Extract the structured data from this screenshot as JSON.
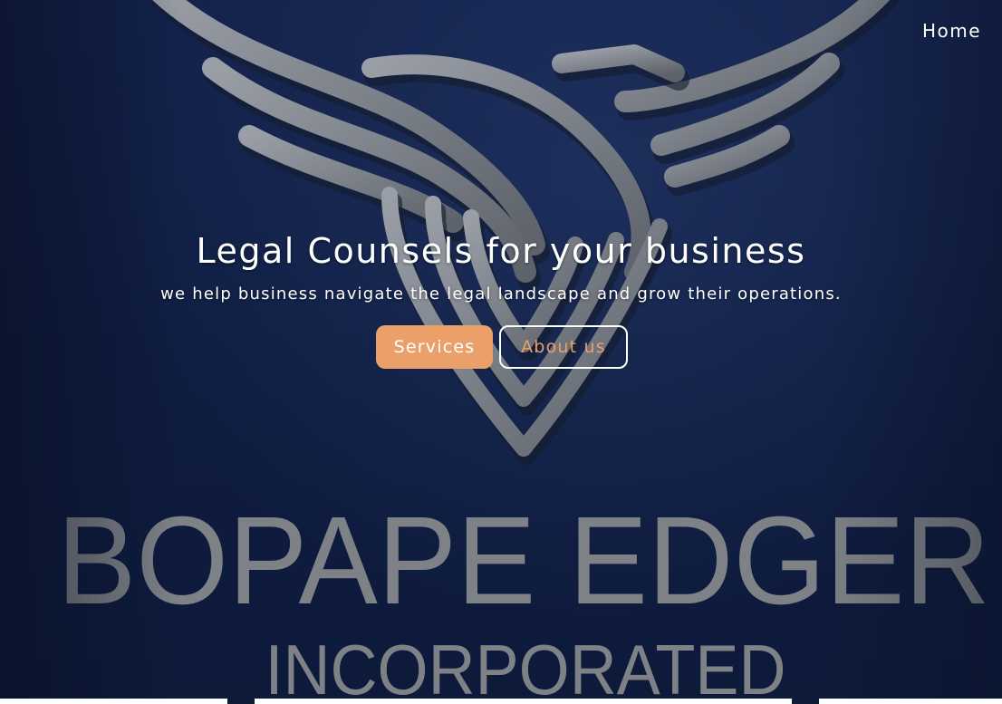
{
  "nav": {
    "home_label": "Home"
  },
  "hero": {
    "headline": "Legal Counsels for your business",
    "subheadline": "we help business navigate the legal landscape and grow their operations.",
    "services_label": "Services",
    "about_label": "About us"
  },
  "brand": {
    "wordmark_line1": "BOPAPE EDGER",
    "wordmark_line2": "INCORPORATED"
  },
  "icons": {
    "logo": "phoenix-logo-icon"
  },
  "colors": {
    "accent": "#eba06a",
    "background": "#0f1d3c",
    "logo_gray": "#808080",
    "text": "#ffffff"
  }
}
